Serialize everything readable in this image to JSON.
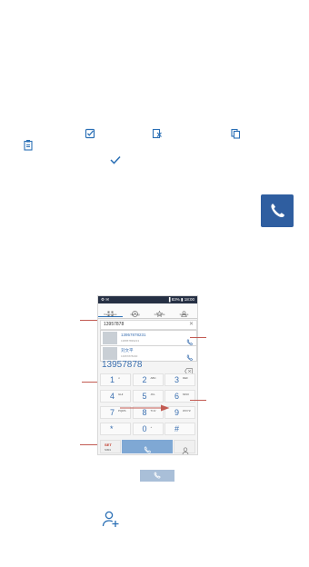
{
  "phone": {
    "status": {
      "left": "⚙ ✉",
      "right": "▐ 83% ▮ 18:00"
    },
    "tabs": [
      "Favourites",
      "Call log",
      "Contacts",
      "Groups"
    ],
    "number_field": {
      "value": "13957878",
      "clear": "✕"
    },
    "candidates": [
      {
        "number": "13957878231",
        "sub": "138957839213"
      },
      {
        "number": "刘文平",
        "sub": "13957878200"
      }
    ],
    "typed_number": "13957878",
    "keys": [
      {
        "num": "1",
        "sub": "∞"
      },
      {
        "num": "2",
        "sub": "ABC"
      },
      {
        "num": "3",
        "sub": "DEF"
      },
      {
        "num": "4",
        "sub": "GHI"
      },
      {
        "num": "5",
        "sub": "JKL"
      },
      {
        "num": "6",
        "sub": "MNO"
      },
      {
        "num": "7",
        "sub": "PQRS"
      },
      {
        "num": "8",
        "sub": "TUV"
      },
      {
        "num": "9",
        "sub": "WXYZ"
      },
      {
        "num": "*",
        "sub": ""
      },
      {
        "num": "0",
        "sub": "+"
      },
      {
        "num": "#",
        "sub": ""
      }
    ],
    "bottom": {
      "set_top": "SET",
      "set_bottom": "SIM1"
    }
  },
  "colors": {
    "accent": "#2a6fb5",
    "dial_blue": "#3a6fb0",
    "annotation": "#c25a52",
    "call_tile": "#2f5ea0"
  },
  "icons": [
    "checklist-icon",
    "edit-checkbox-icon",
    "export-icon",
    "copy-icon",
    "clipboard-icon",
    "checkmark-icon",
    "phone-app-icon",
    "call-button-icon",
    "add-contact-icon"
  ]
}
